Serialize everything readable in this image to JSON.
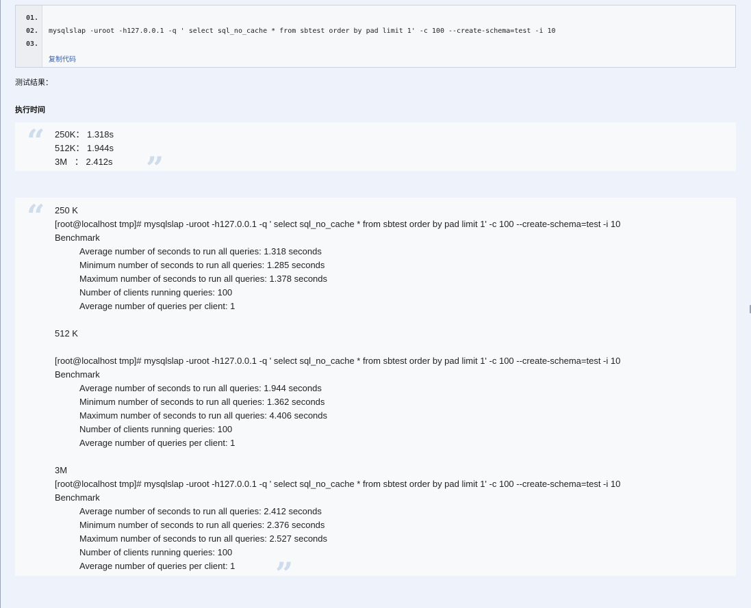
{
  "code": {
    "line_numbers": [
      "01.",
      "02.",
      "03."
    ],
    "line": "mysqlslap -uroot -h127.0.0.1 -q ' select sql_no_cache * from sbtest order by pad limit 1' -c 100 --create-schema=test -i 10",
    "copy_label": "复制代码"
  },
  "labels": {
    "test_result": "测试结果：",
    "exec_time": "执行时间"
  },
  "summary": [
    "250K： 1.318s",
    "512K： 1.944s",
    "3M   ： 2.412s"
  ],
  "quote_marks": {
    "open": "“",
    "close": "”"
  },
  "details": [
    {
      "text": "250 K",
      "indent": false
    },
    {
      "text": "[root@localhost tmp]# mysqlslap -uroot -h127.0.0.1 -q ' select sql_no_cache * from sbtest order by pad limit 1' -c 100 --create-schema=test -i 10",
      "indent": false
    },
    {
      "text": "Benchmark",
      "indent": false
    },
    {
      "text": "Average number of seconds to run all queries: 1.318 seconds",
      "indent": true
    },
    {
      "text": "Minimum number of seconds to run all queries: 1.285 seconds",
      "indent": true
    },
    {
      "text": "Maximum number of seconds to run all queries: 1.378 seconds",
      "indent": true
    },
    {
      "text": "Number of clients running queries: 100",
      "indent": true
    },
    {
      "text": "Average number of queries per client: 1",
      "indent": true
    },
    {
      "text": "",
      "indent": false
    },
    {
      "text": "512 K",
      "indent": false
    },
    {
      "text": "",
      "indent": false
    },
    {
      "text": "[root@localhost tmp]# mysqlslap -uroot -h127.0.0.1 -q ' select sql_no_cache * from sbtest order by pad limit 1' -c 100 --create-schema=test -i 10",
      "indent": false
    },
    {
      "text": "Benchmark",
      "indent": false
    },
    {
      "text": "Average number of seconds to run all queries: 1.944 seconds",
      "indent": true
    },
    {
      "text": "Minimum number of seconds to run all queries: 1.362 seconds",
      "indent": true
    },
    {
      "text": "Maximum number of seconds to run all queries: 4.406 seconds",
      "indent": true
    },
    {
      "text": "Number of clients running queries: 100",
      "indent": true
    },
    {
      "text": "Average number of queries per client: 1",
      "indent": true
    },
    {
      "text": "",
      "indent": false
    },
    {
      "text": "3M",
      "indent": false
    },
    {
      "text": "[root@localhost tmp]# mysqlslap -uroot -h127.0.0.1 -q ' select sql_no_cache * from sbtest order by pad limit 1' -c 100 --create-schema=test -i 10",
      "indent": false
    },
    {
      "text": "Benchmark",
      "indent": false
    },
    {
      "text": "Average number of seconds to run all queries: 2.412 seconds",
      "indent": true
    },
    {
      "text": "Minimum number of seconds to run all queries: 2.376 seconds",
      "indent": true
    },
    {
      "text": "Maximum number of seconds to run all queries: 2.527 seconds",
      "indent": true
    },
    {
      "text": "Number of clients running queries: 100",
      "indent": true
    },
    {
      "text": "Average number of queries per client: 1",
      "indent": true
    }
  ]
}
